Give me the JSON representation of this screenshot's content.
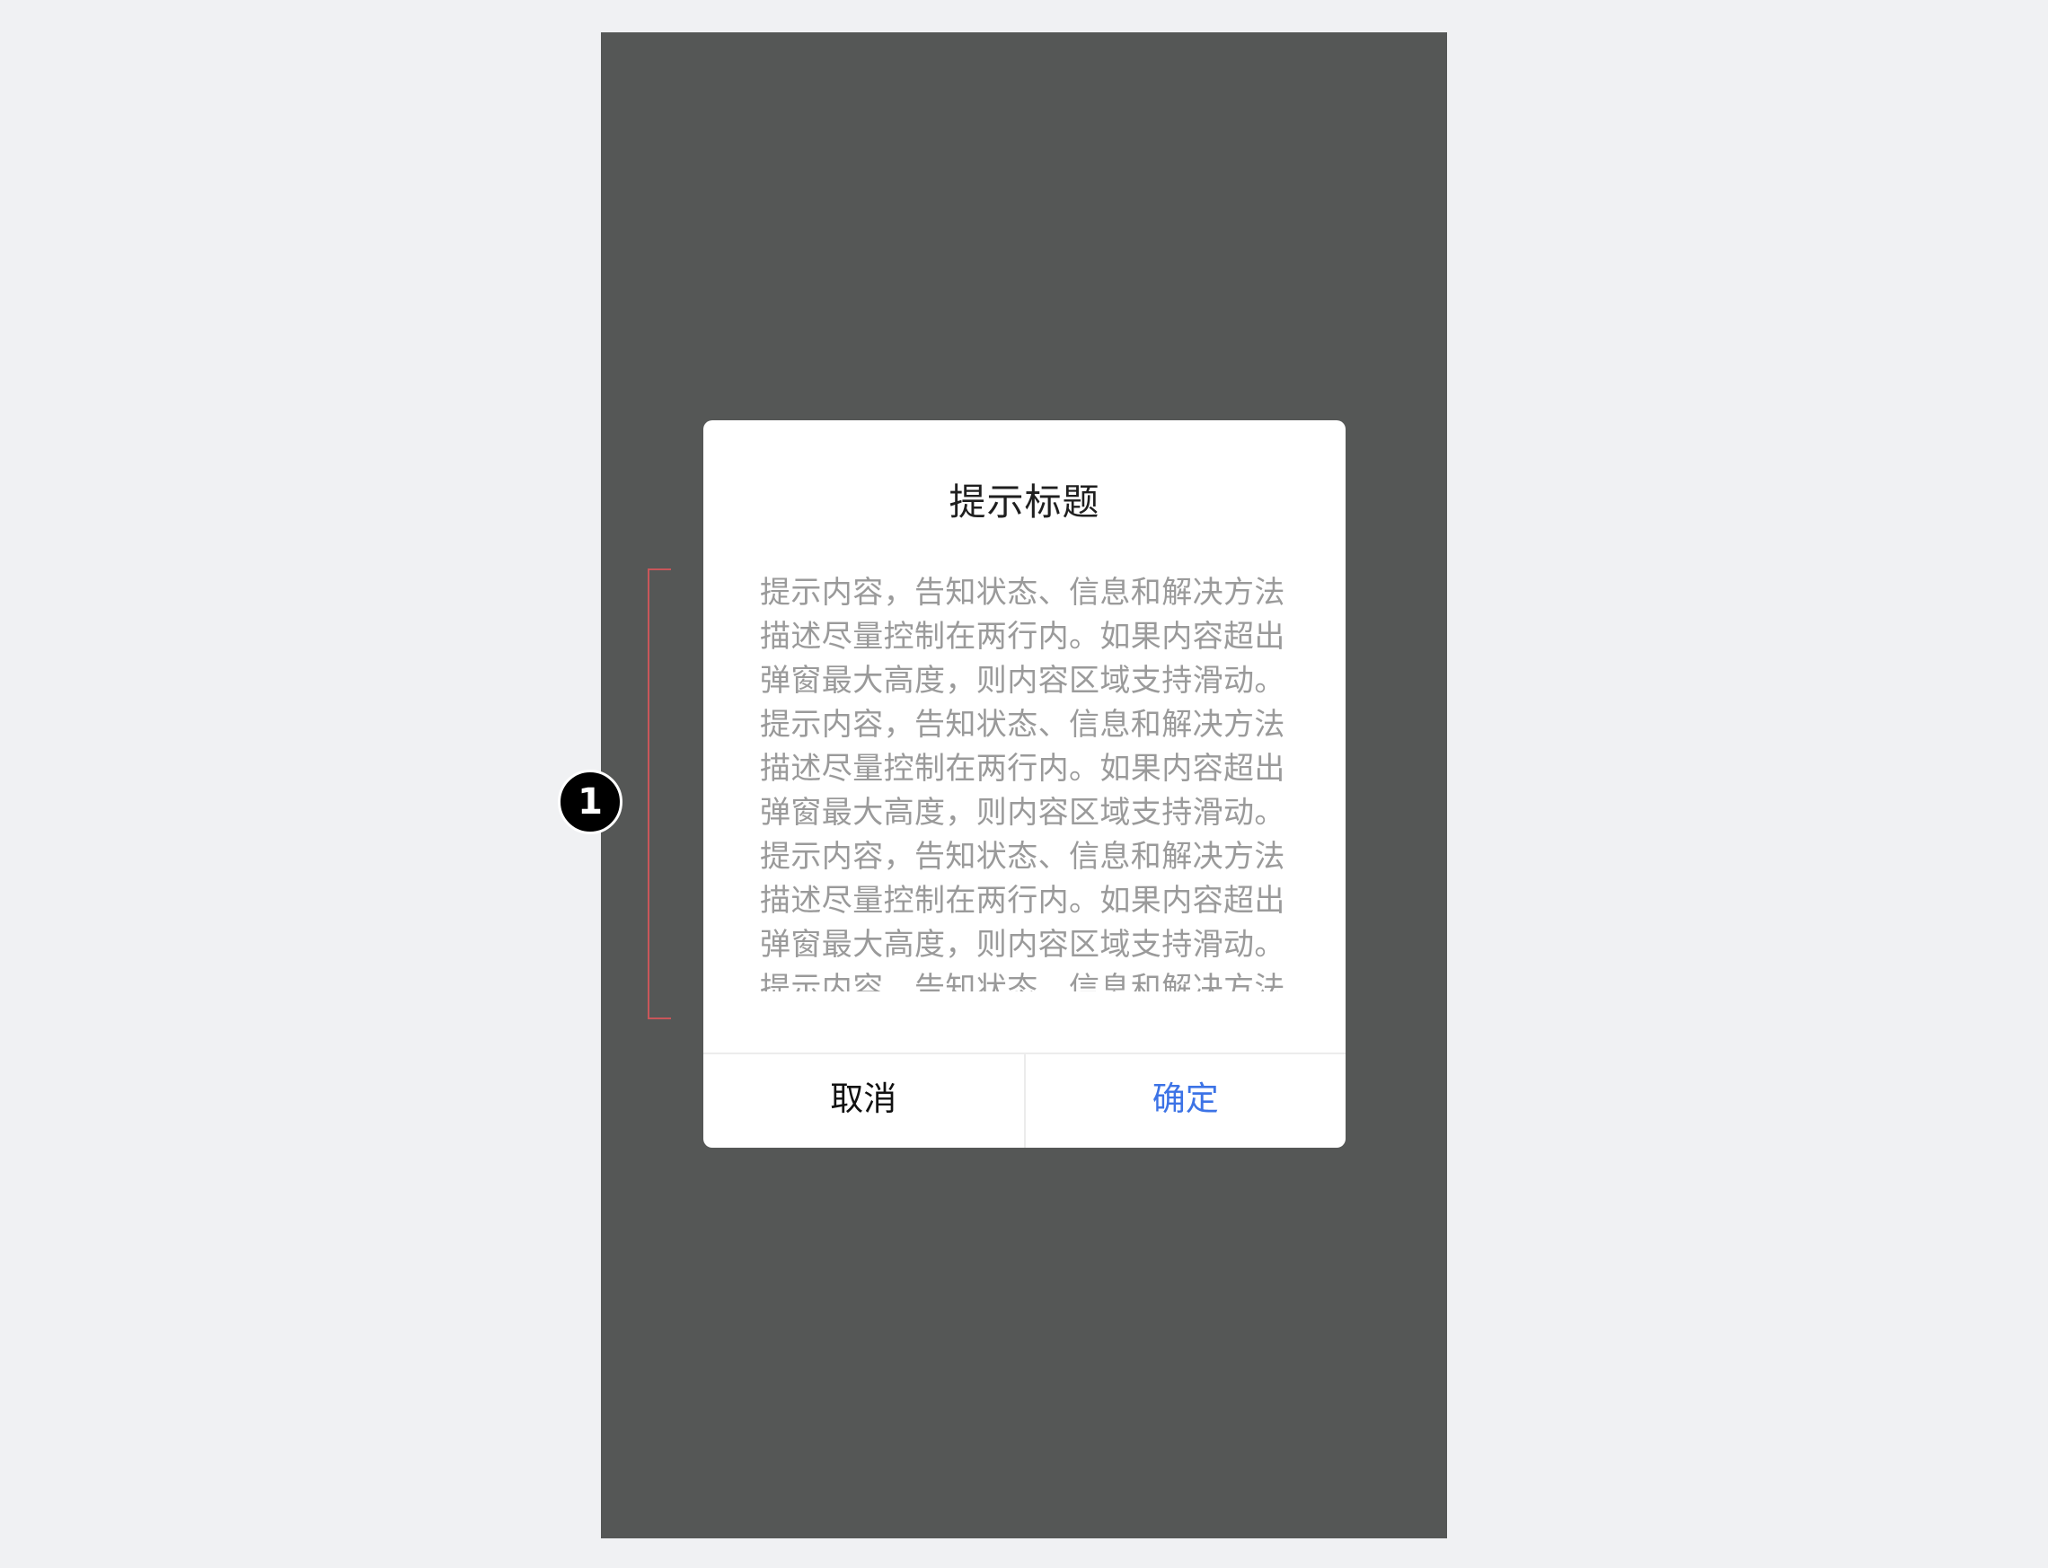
{
  "dialog": {
    "title": "提示标题",
    "body_lines": [
      "提示内容，告知状态、信息和解决方法",
      "描述尽量控制在两行内。如果内容超出",
      "弹窗最大高度，则内容区域支持滑动。",
      "提示内容，告知状态、信息和解决方法",
      "描述尽量控制在两行内。如果内容超出",
      "弹窗最大高度，则内容区域支持滑动。",
      "提示内容，告知状态、信息和解决方法",
      "描述尽量控制在两行内。如果内容超出",
      "弹窗最大高度，则内容区域支持滑动。",
      "提示内容，告知状态、信息和解决方法"
    ],
    "cancel_label": "取消",
    "confirm_label": "确定"
  },
  "annotation": {
    "marker_label": "1"
  },
  "colors": {
    "page_background": "#f0f1f3",
    "overlay": "#555756",
    "confirm_accent": "#3c73e6",
    "bracket": "#c9565a",
    "body_text": "#9a9a9a"
  }
}
